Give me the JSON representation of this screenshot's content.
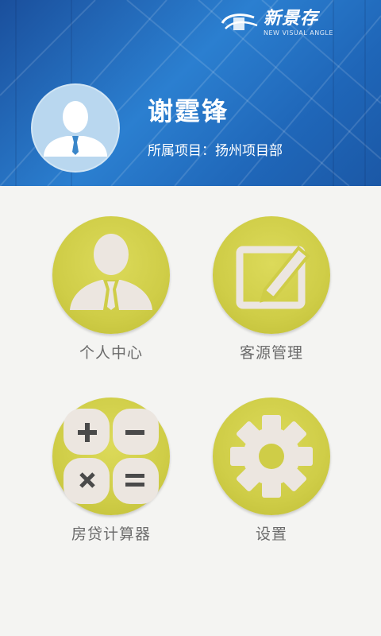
{
  "header": {
    "logo_text": "新景存",
    "logo_subtext": "NEW VISUAL ANGLE",
    "user_name": "谢霆锋",
    "project_line": "所属项目：扬州项目部"
  },
  "menu": [
    {
      "label": "个人中心",
      "icon": "person-icon"
    },
    {
      "label": "客源管理",
      "icon": "edit-icon"
    },
    {
      "label": "房贷计算器",
      "icon": "calculator-icon"
    },
    {
      "label": "设置",
      "icon": "gear-icon"
    }
  ],
  "colors": {
    "header_blue": "#2b7fd0",
    "tile_yellow": "#cfcd47",
    "icon_fill": "#ece6e0",
    "label_gray": "#6b6b6b"
  }
}
